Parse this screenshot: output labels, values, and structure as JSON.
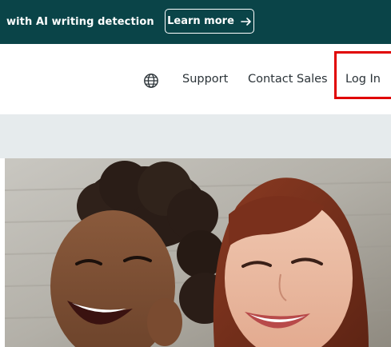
{
  "banner": {
    "text": "with AI writing detection",
    "learn_more_label": "Learn more",
    "background_color": "#0a4448"
  },
  "nav": {
    "globe_icon": "globe-icon",
    "links": {
      "support": "Support",
      "contact_sales": "Contact Sales",
      "login": "Log In"
    },
    "highlight_color": "#e00000"
  },
  "hero": {
    "image_description_icon": "hero-photo"
  }
}
